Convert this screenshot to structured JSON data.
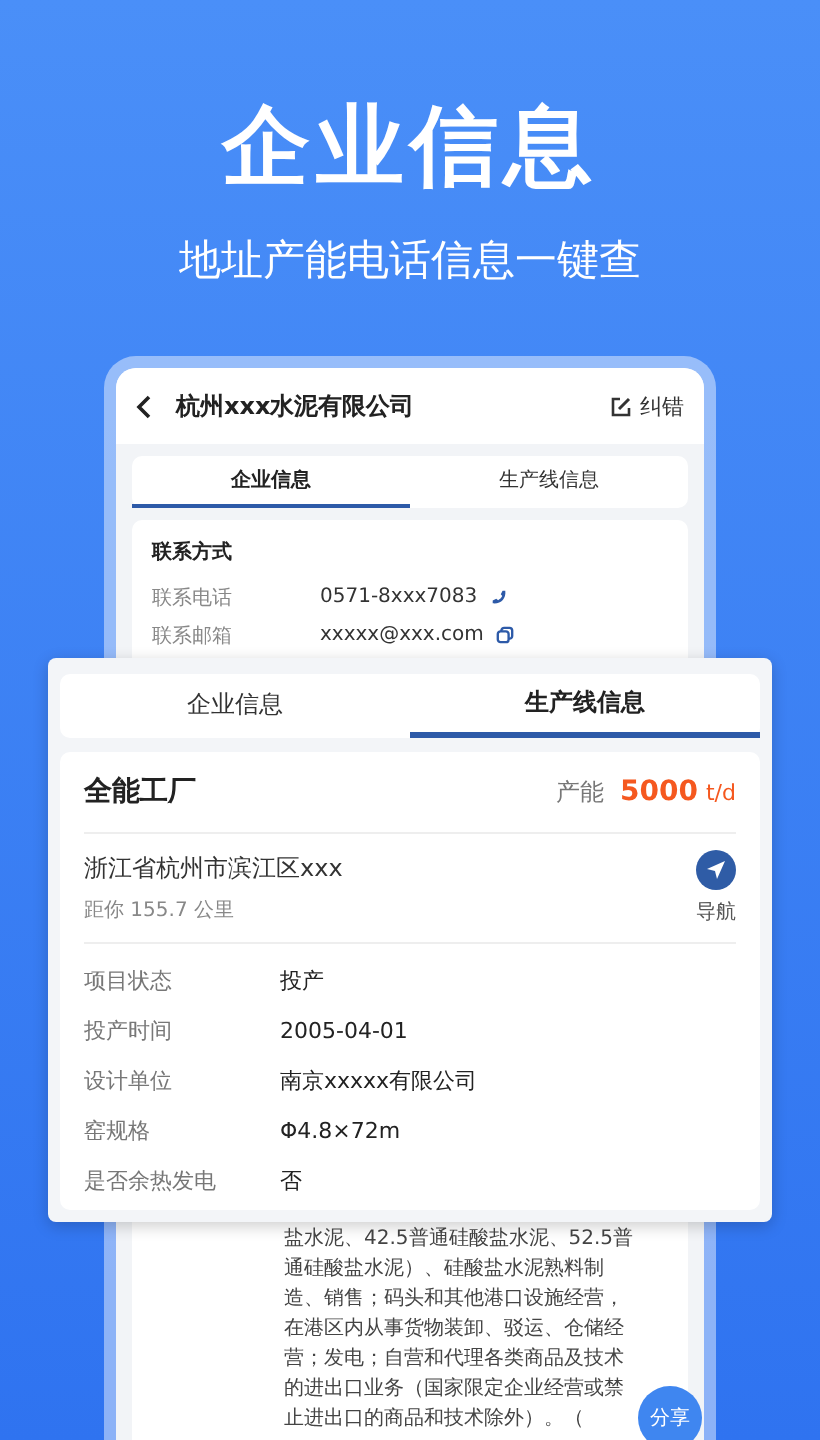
{
  "hero": {
    "title": "企业信息",
    "subtitle": "地址产能电话信息一键查"
  },
  "phone": {
    "header": {
      "title": "杭州xxx水泥有限公司",
      "action": "纠错"
    },
    "tabs": [
      {
        "label": "企业信息",
        "selected": true
      },
      {
        "label": "生产线信息",
        "selected": false
      }
    ],
    "contact": {
      "heading": "联系方式",
      "rows": [
        {
          "label": "联系电话",
          "value": "0571-8xxx7083",
          "kind": "phone"
        },
        {
          "label": "联系邮箱",
          "value": "xxxxx@xxx.com",
          "kind": "copy"
        }
      ]
    },
    "scope_lines": [
      "盐水泥、42.5普通硅酸盐水泥、52.5普",
      "通硅酸盐水泥）、硅酸盐水泥熟料制",
      "造、销售；码头和其他港口设施经营，",
      "在港区内从事货物装卸、驳运、仓储经",
      "营；发电；自营和代理各类商品及技术",
      "的进出口业务（国家限定企业经营或禁",
      "止进出口的商品和技术除外）。（"
    ],
    "share_button": "分享"
  },
  "overlay": {
    "tabs": [
      {
        "label": "企业信息",
        "selected": false
      },
      {
        "label": "生产线信息",
        "selected": true
      }
    ],
    "factory": {
      "name": "全能工厂",
      "capacity_label": "产能",
      "capacity_value": "5000",
      "capacity_unit": "t/d",
      "address": "浙江省杭州市滨江区xxx",
      "distance": "距你 155.7 公里",
      "nav_label": "导航"
    },
    "details": [
      {
        "label": "项目状态",
        "value": "投产"
      },
      {
        "label": "投产时间",
        "value": "2005-04-01"
      },
      {
        "label": "设计单位",
        "value": "南京xxxxx有限公司"
      },
      {
        "label": "窑规格",
        "value": "Φ4.8×72m"
      },
      {
        "label": "是否余热发电",
        "value": "否"
      }
    ]
  }
}
